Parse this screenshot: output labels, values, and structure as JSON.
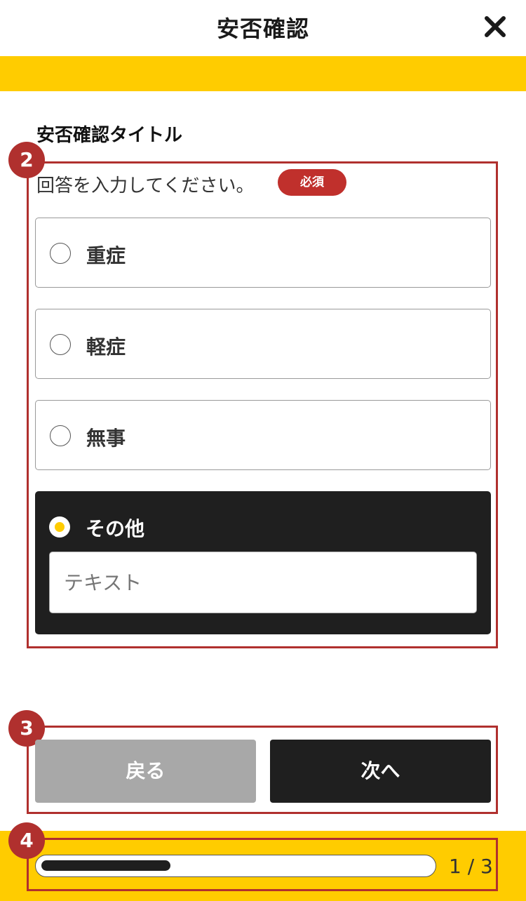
{
  "header": {
    "title": "安否確認",
    "close_icon": "close-icon"
  },
  "section": {
    "title": "安否確認タイトル"
  },
  "question": {
    "prompt": "回答を入力してください。",
    "required_label": "必須",
    "options": [
      {
        "label": "重症",
        "selected": false
      },
      {
        "label": "軽症",
        "selected": false
      },
      {
        "label": "無事",
        "selected": false
      },
      {
        "label": "その他",
        "selected": true
      }
    ],
    "other_input": {
      "placeholder": "テキスト",
      "value": ""
    }
  },
  "buttons": {
    "back_label": "戻る",
    "next_label": "次へ"
  },
  "progress": {
    "current": 1,
    "total": 3,
    "label": "1 / 3",
    "fraction": 0.333
  },
  "annotations": {
    "badge_2": "2",
    "badge_3": "3",
    "badge_4": "4"
  },
  "colors": {
    "accent": "#ffcc00",
    "dark": "#1f1f1f",
    "required": "#c0302c",
    "annotation": "#b0302e",
    "disabled": "#a8a8a8"
  }
}
